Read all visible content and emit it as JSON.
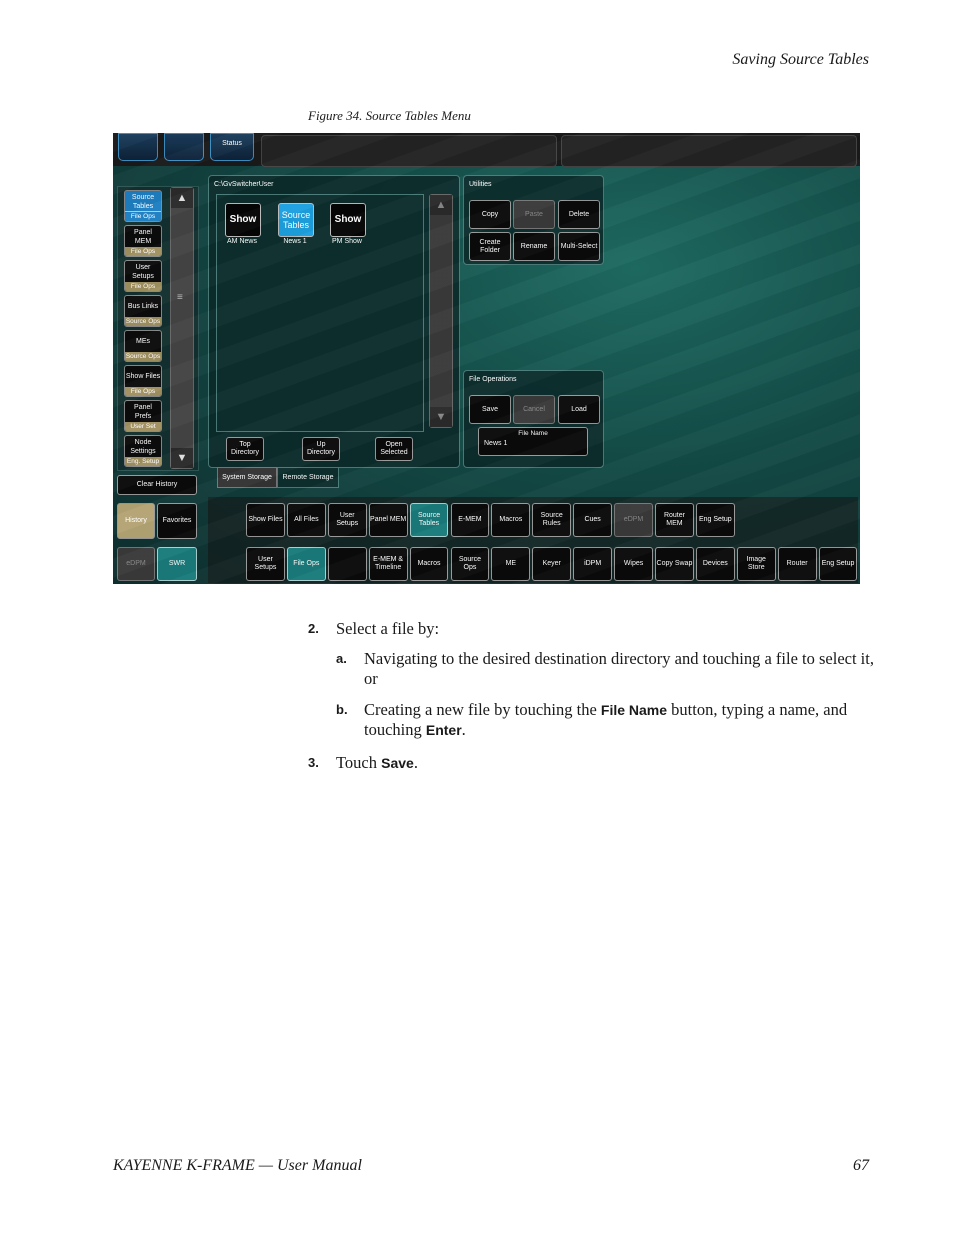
{
  "header": {
    "section_title": "Saving Source Tables"
  },
  "figure": {
    "caption": "Figure 34.  Source Tables Menu"
  },
  "screen": {
    "top": {
      "status_label": "Status"
    },
    "sidebar": {
      "items": [
        {
          "label": "Source Tables",
          "tag": "File Ops"
        },
        {
          "label": "Panel MEM",
          "tag": "File Ops"
        },
        {
          "label": "User Setups",
          "tag": "File Ops"
        },
        {
          "label": "Bus Links",
          "tag": "Source Ops"
        },
        {
          "label": "MEs",
          "tag": "Source Ops"
        },
        {
          "label": "Show Files",
          "tag": "File Ops"
        },
        {
          "label": "Panel Prefs",
          "tag": "User Set"
        },
        {
          "label": "Node Settings",
          "tag": "Eng. Setup"
        }
      ],
      "clear_history": "Clear History",
      "history": "History",
      "favorites": "Favorites",
      "edpm": "eDPM",
      "swr": "SWR"
    },
    "browser": {
      "path": "C:\\GvSwitcherUser",
      "files": [
        {
          "icon": "Show",
          "name": "AM News"
        },
        {
          "icon": "Source Tables",
          "name": "News 1"
        },
        {
          "icon": "Show",
          "name": "PM Show"
        }
      ],
      "top_directory": "Top Directory",
      "up_directory": "Up Directory",
      "open_selected": "Open Selected",
      "storage_tabs": [
        "System Storage",
        "Remote Storage"
      ]
    },
    "utilities": {
      "title": "Utilities",
      "buttons": [
        "Copy",
        "Paste",
        "Delete",
        "Create Folder",
        "Rename",
        "Multi-Select"
      ]
    },
    "file_operations": {
      "title": "File Operations",
      "buttons": [
        "Save",
        "Cancel",
        "Load"
      ],
      "file_name_label": "File Name",
      "file_name_value": "News 1"
    },
    "menu_row1": [
      "Show Files",
      "All Files",
      "User Setups",
      "Panel MEM",
      "Source Tables",
      "E-MEM",
      "Macros",
      "Source Rules",
      "Cues",
      "eDPM",
      "Router MEM",
      "Eng Setup"
    ],
    "menu_row2": [
      "User Setups",
      "File Ops",
      "",
      "E-MEM & Timeline",
      "Macros",
      "Source Ops",
      "ME",
      "Keyer",
      "iDPM",
      "Wipes",
      "Copy Swap",
      "Devices",
      "Image Store",
      "Router",
      "Eng Setup"
    ]
  },
  "steps": {
    "s2_num": "2.",
    "s2_text": "Select a file by:",
    "a_num": "a.",
    "a_text": "Navigating to the desired destination directory and touching a file to select it, or",
    "b_num": "b.",
    "b_pre": "Creating a new file by touching the ",
    "b_kw1": "File Name",
    "b_mid": " button, typing a name, and touching ",
    "b_kw2": "Enter",
    "b_end": ".",
    "s3_num": "3.",
    "s3_pre": "Touch ",
    "s3_kw": "Save",
    "s3_end": "."
  },
  "footer": {
    "manual": "KAYENNE K-FRAME  —  User Manual",
    "page": "67"
  }
}
